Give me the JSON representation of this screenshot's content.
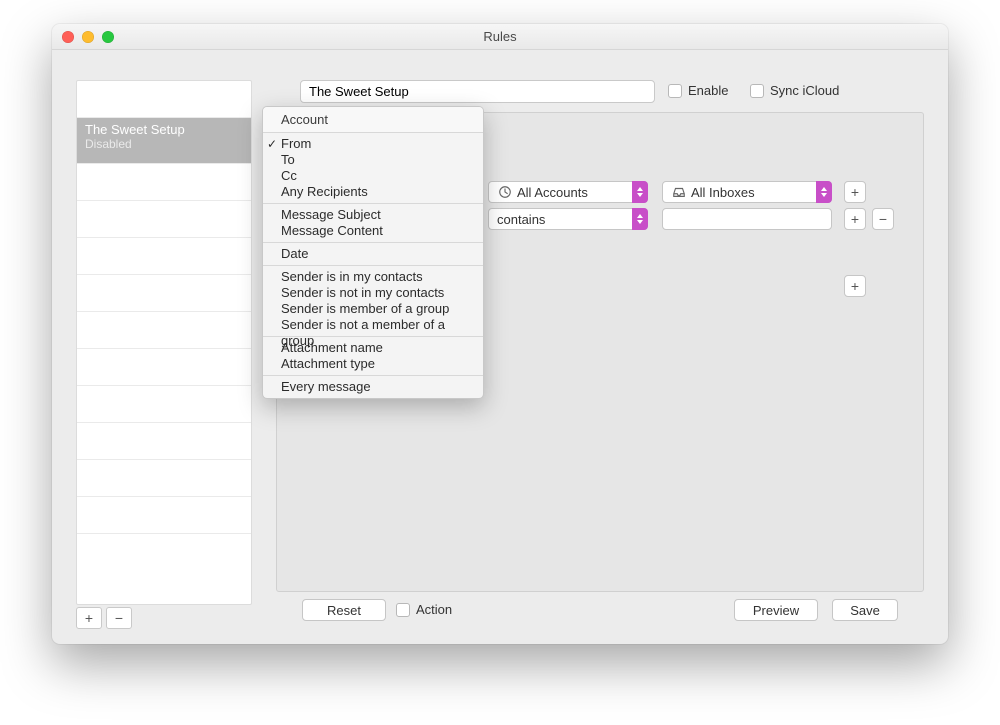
{
  "window": {
    "title": "Rules"
  },
  "sidebar": {
    "selected": {
      "title": "The Sweet Setup",
      "subtitle": "Disabled"
    },
    "add_label": "+",
    "remove_label": "−"
  },
  "rule": {
    "name": "The Sweet Setup",
    "enable_label": "Enable",
    "sync_label": "Sync iCloud"
  },
  "condition_popup": {
    "header": "Account",
    "selected": "From",
    "groups": [
      [
        "From",
        "To",
        "Cc",
        "Any Recipients"
      ],
      [
        "Message Subject",
        "Message Content"
      ],
      [
        "Date"
      ],
      [
        "Sender is in my contacts",
        "Sender is not in my contacts",
        "Sender is member of a group",
        "Sender is not a member of a group"
      ],
      [
        "Attachment name",
        "Attachment type"
      ],
      [
        "Every message"
      ]
    ]
  },
  "conditions": {
    "account_label": "All Accounts",
    "inbox_label": "All Inboxes",
    "match_label": "contains",
    "value": ""
  },
  "buttons": {
    "reset": "Reset",
    "action": "Action",
    "preview": "Preview",
    "save": "Save",
    "plus": "+",
    "minus": "−"
  }
}
